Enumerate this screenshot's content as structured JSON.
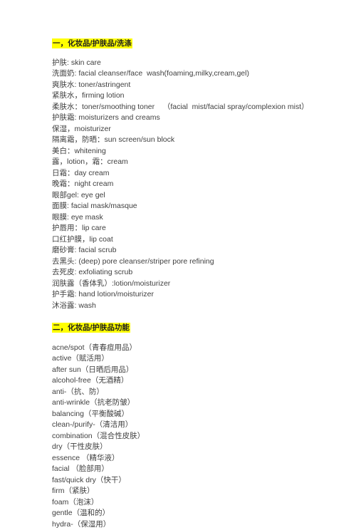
{
  "document": {
    "type": "text-document",
    "background_color": "#ffffff",
    "text_color": "#404040",
    "highlight_color": "#FFFF00",
    "sections": [
      {
        "heading": "一，化妆品/护肤品/洗涤",
        "heading_highlighted": true,
        "items": [
          "护肤: skin care",
          "洗面奶: facial cleanser/face  wash(foaming,milky,cream,gel)",
          "爽肤水: toner/astringent",
          "紧肤水，firming lotion",
          "柔肤水：toner/smoothing toner    （facial  mist/facial spray/complexion mist）",
          "护肤霜: moisturizers and creams",
          "保湿，moisturizer",
          "隔离霜，防晒：sun screen/sun block",
          "美白：whitening",
          "露，lotion，霜：cream",
          "日霜：day cream",
          "晚霜：night cream",
          "眼部gel: eye gel",
          "面膜: facial mask/masque",
          "眼膜: eye mask",
          "护唇用：lip care",
          "口红护膜，lip coat",
          "磨砂膏: facial scrub",
          "去黑头: (deep) pore cleanser/striper pore refining",
          "去死皮: exfoliating scrub",
          "润肤露（香体乳）:lotion/moisturizer",
          "护手霜: hand lotion/moisturizer",
          "沐浴露: wash"
        ]
      },
      {
        "heading": "二，化妆品/护肤品功能",
        "heading_highlighted": true,
        "items": [
          "acne/spot（青春痘用品）",
          "active（赋活用）",
          "after sun（日晒后用品）",
          "alcohol-free（无酒精）",
          "anti-（抗、防）",
          "anti-wrinkle（抗老防皱）",
          "balancing（平衡酸碱）",
          "clean-/purify-（清洁用）",
          "combination（混合性皮肤）",
          "dry（干性皮肤）",
          "essence （精华液）",
          "facial （脸部用）",
          "fast/quick dry（快干）",
          "firm（紧肤）",
          "foam（泡沫）",
          "gentle（温和的）",
          "hydra-（保湿用）"
        ]
      }
    ]
  }
}
